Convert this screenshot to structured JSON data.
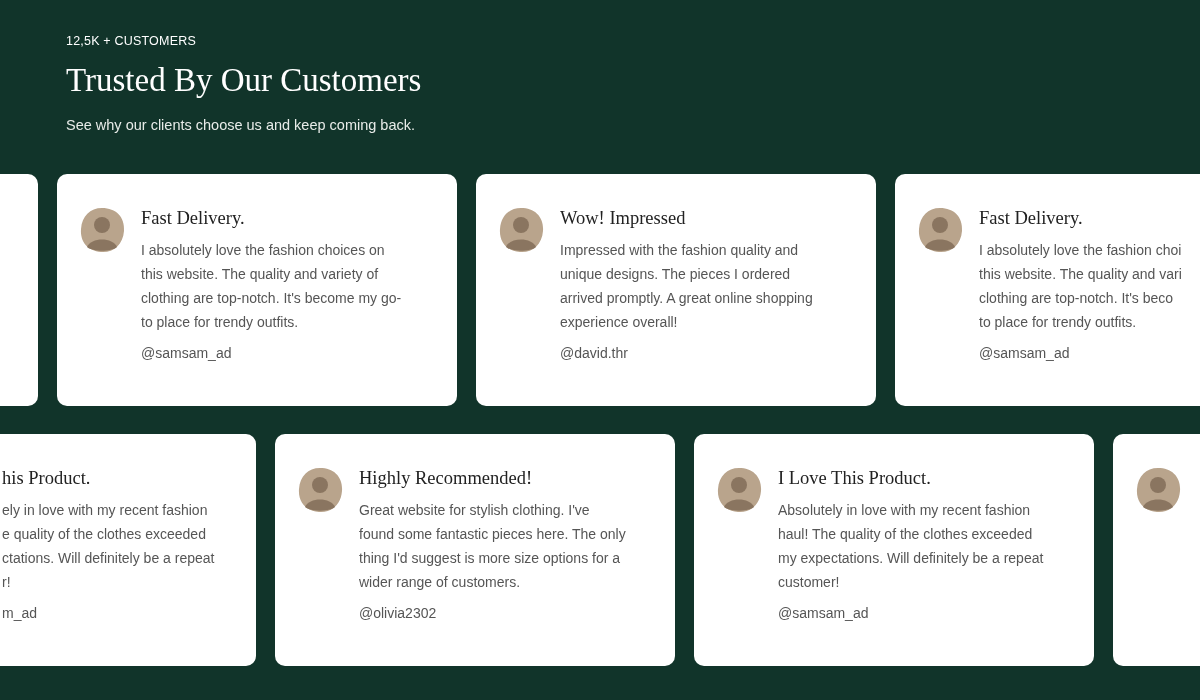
{
  "header": {
    "eyebrow": "12,5K + CUSTOMERS",
    "title": "Trusted By Our Customers",
    "subtitle": "See why our clients choose us and keep coming back."
  },
  "rows": [
    {
      "cards": [
        {
          "kind": "clipped-left"
        },
        {
          "kind": "full",
          "avatar": true,
          "title": "Fast Delivery.",
          "lines": [
            "I absolutely love the fashion choices on",
            "this website. The quality and variety of",
            "clothing are top-notch. It's become my go-",
            "to place for trendy outfits."
          ],
          "handle": "@samsam_ad"
        },
        {
          "kind": "full",
          "avatar": true,
          "title": "Wow! Impressed",
          "lines": [
            "Impressed with the fashion quality and",
            "unique designs. The pieces I ordered",
            "arrived promptly. A great online shopping",
            "experience overall!"
          ],
          "handle": "@david.thr"
        },
        {
          "kind": "clipped-right",
          "avatar": true,
          "title": "Fast Delivery.",
          "lines": [
            "I absolutely love the fashion choi",
            "this website. The quality and vari",
            "clothing are top-notch. It's beco",
            "to place for trendy outfits."
          ],
          "handle": "@samsam_ad"
        }
      ]
    },
    {
      "cards": [
        {
          "kind": "clipped-left",
          "title": "his Product.",
          "lines": [
            "ely in love with my recent fashion",
            "e quality of the clothes exceeded",
            "ctations. Will definitely be a repeat",
            "r!"
          ],
          "handle": "m_ad"
        },
        {
          "kind": "full",
          "avatar": true,
          "title": "Highly Recommended!",
          "lines": [
            "Great website for stylish clothing. I've",
            "found some fantastic pieces here. The only",
            "thing I'd suggest is more size options for a",
            "wider range of customers."
          ],
          "handle": "@olivia2302"
        },
        {
          "kind": "full",
          "avatar": true,
          "title": "I Love This Product.",
          "lines": [
            "Absolutely in love with my recent fashion",
            "haul! The quality of the clothes exceeded",
            "my expectations. Will definitely be a repeat",
            "customer!"
          ],
          "handle": "@samsam_ad"
        },
        {
          "kind": "clipped-right",
          "avatar": true
        }
      ]
    }
  ]
}
